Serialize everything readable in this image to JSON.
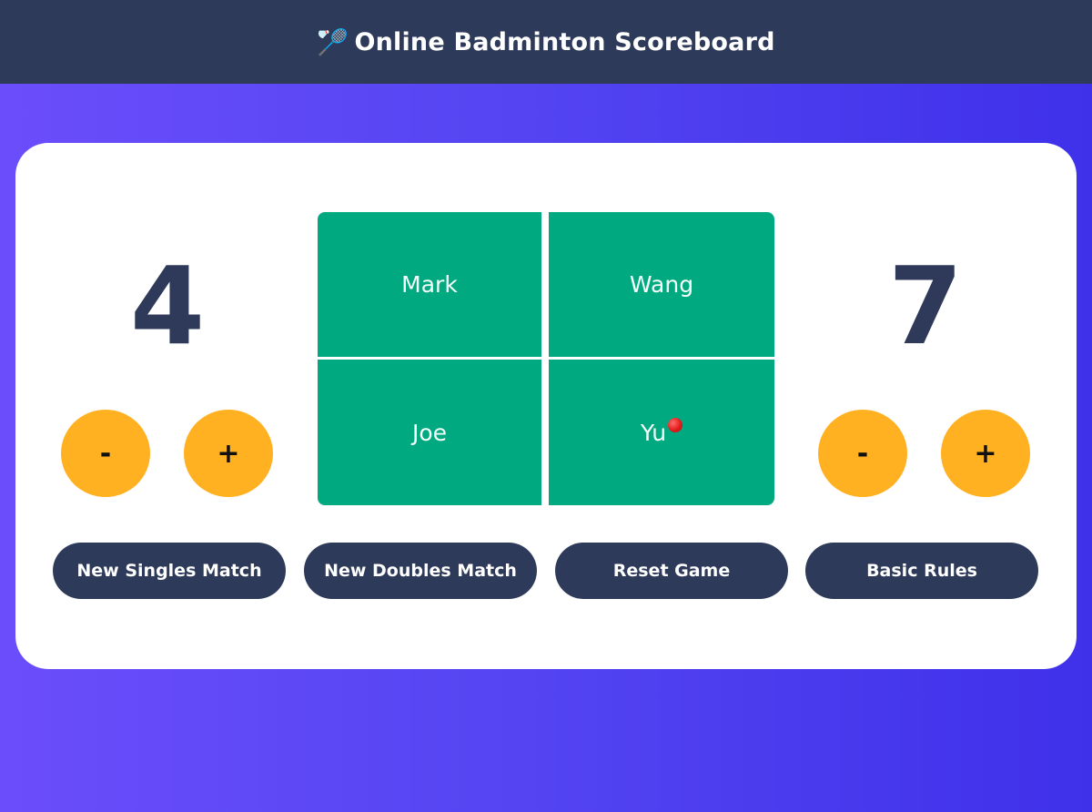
{
  "header": {
    "icon": "🏸",
    "title": "Online Badminton Scoreboard"
  },
  "scores": {
    "left": "4",
    "right": "7"
  },
  "controls": {
    "minus_label": "-",
    "plus_label": "+"
  },
  "court": {
    "top_left": "Mark",
    "top_right": "Wang",
    "bottom_left": "Joe",
    "bottom_right": "Yu",
    "server": "Yu"
  },
  "actions": {
    "singles": "New Singles Match",
    "doubles": "New Doubles Match",
    "reset": "Reset Game",
    "rules": "Basic Rules"
  },
  "colors": {
    "header_bg": "#2e3a59",
    "court": "#00a97f",
    "score_button": "#ffb122",
    "action_button": "#2e3a59",
    "score_text": "#2f3a5b",
    "serve_indicator": "#e41b1b"
  },
  "icons": {
    "title_icon": "badminton-icon",
    "serve_indicator": "serve-indicator-icon"
  }
}
